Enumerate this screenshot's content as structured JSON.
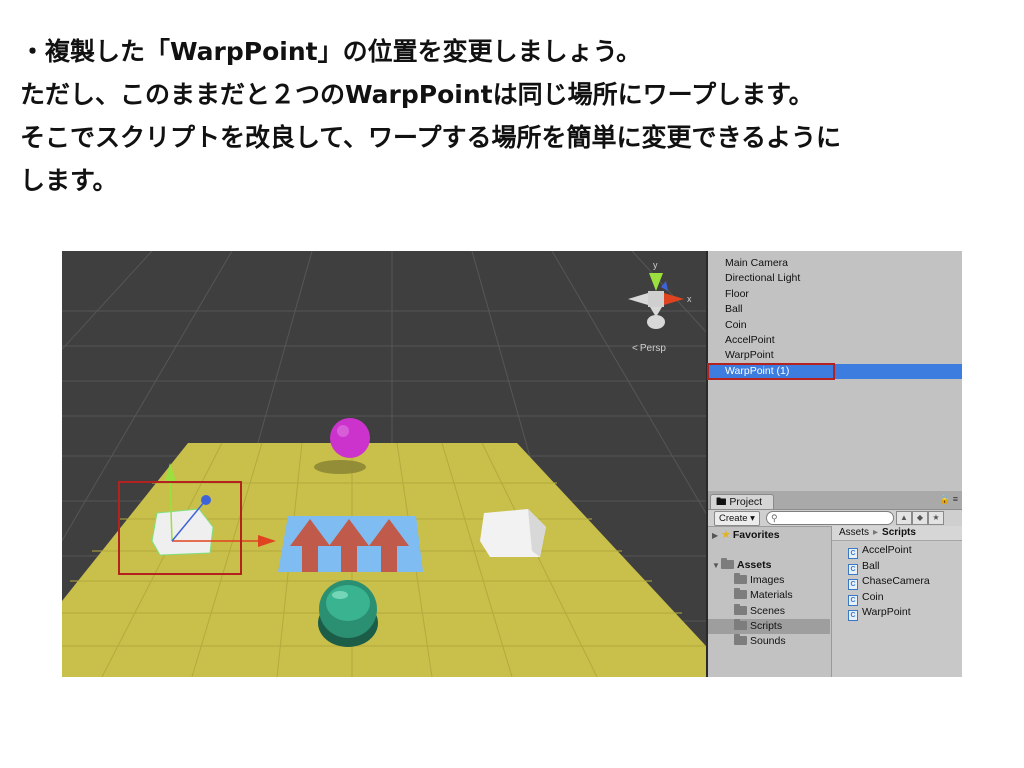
{
  "instructions": [
    "・複製した「WarpPoint」の位置を変更しましょう。",
    "ただし、このままだと２つのWarpPointは同じ場所にワープします。",
    "そこでスクリプトを改良して、ワープする場所を簡単に変更できるように",
    "します。"
  ],
  "scene": {
    "gizmo_label_y": "y",
    "gizmo_label_x": "x",
    "persp_label": "Persp",
    "colors": {
      "background": "#3f3f3f",
      "floor": "#c9bf4b",
      "ball": "#cc33cc",
      "arrow_pad": "#7fbcf2",
      "arrows": "#c05a4a",
      "highlight": "#b3221f"
    }
  },
  "hierarchy": {
    "items": [
      "Main Camera",
      "Directional Light",
      "Floor",
      "Ball",
      "Coin",
      "AccelPoint",
      "WarpPoint",
      "WarpPoint (1)"
    ],
    "selected_index": 7
  },
  "project": {
    "tab_label": "Project",
    "create_label": "Create",
    "favorites_label": "Favorites",
    "assets_label": "Assets",
    "folders": [
      "Images",
      "Materials",
      "Scenes",
      "Scripts",
      "Sounds"
    ],
    "selected_folder": "Scripts",
    "breadcrumb": [
      "Assets",
      "Scripts"
    ],
    "files": [
      "AccelPoint",
      "Ball",
      "ChaseCamera",
      "Coin",
      "WarpPoint"
    ]
  }
}
